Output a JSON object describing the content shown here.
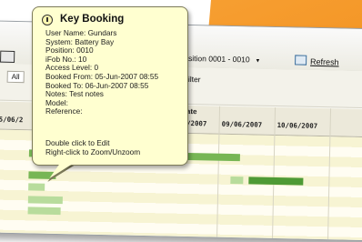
{
  "toolbar": {
    "position_range": "Position 0001 - 0010",
    "refresh_label": "Refresh"
  },
  "filters": {
    "all_tab": "All",
    "filter_label": "Filter"
  },
  "grid": {
    "date_group_label": "ate",
    "columns": [
      "5/06/2",
      "6/2007",
      "09/06/2007",
      "10/06/2007"
    ]
  },
  "tooltip": {
    "title": "Key Booking",
    "lines": [
      "User Name: Gundars",
      "System: Battery Bay",
      "Position: 0010",
      "iFob No.: 10",
      "Access Level: 0",
      "Booked From: 05-Jun-2007 08:55",
      "Booked To: 06-Jun-2007 08:55",
      "Notes: Test notes",
      "Model:",
      "Reference:"
    ],
    "hints": [
      "Double click to Edit",
      "Right-click to Zoom/Unzoom"
    ]
  },
  "colors": {
    "accent_orange": "#f39423",
    "tooltip_bg": "#ffffd0",
    "booking_bar": "#77b655"
  }
}
